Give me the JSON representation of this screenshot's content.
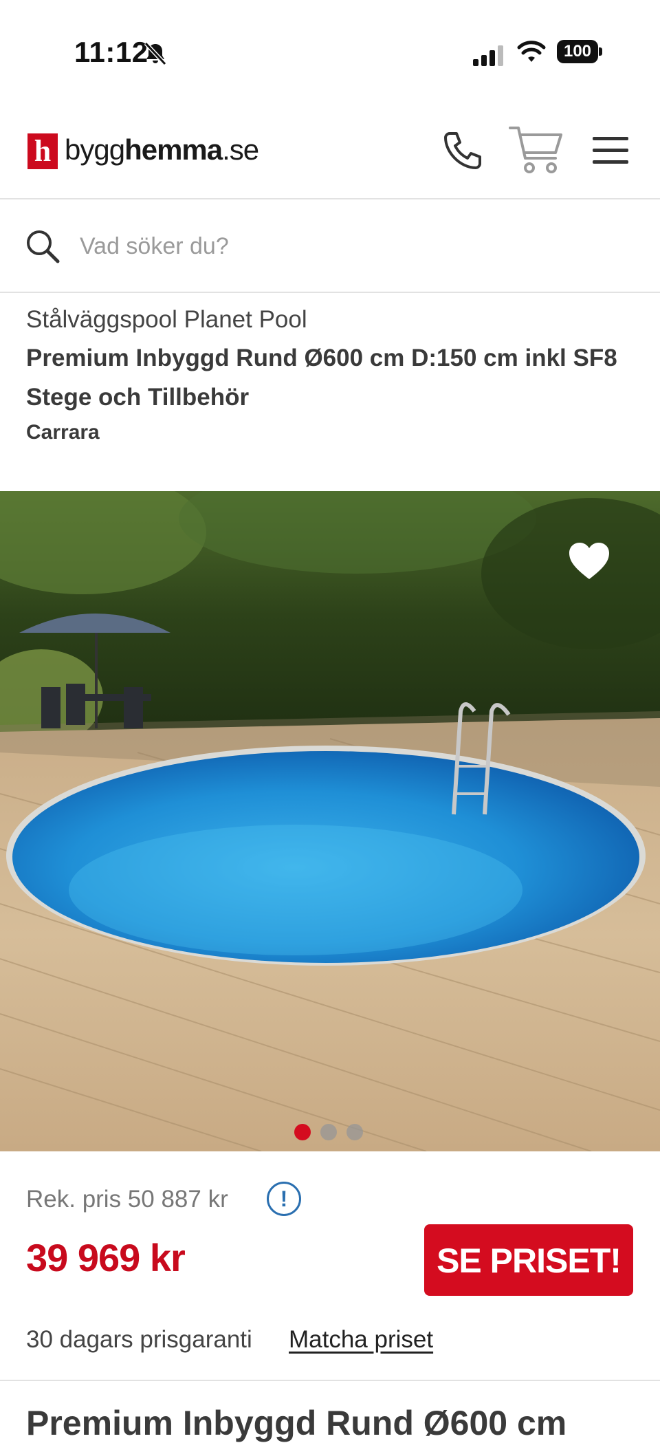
{
  "status": {
    "time": "11:12",
    "battery": "100"
  },
  "header": {
    "logo_letter": "h",
    "logo_prefix": "bygg",
    "logo_bold": "hemma",
    "logo_suffix": ".se"
  },
  "search": {
    "placeholder": "Vad söker du?"
  },
  "product": {
    "series": "Stålväggspool Planet Pool",
    "title": "Premium Inbyggd Rund Ø600 cm D:150 cm inkl SF8 Stege och Tillbehör",
    "brand": "Carrara"
  },
  "gallery": {
    "total_images": 3,
    "active_index": 0
  },
  "pricing": {
    "recommended": "Rek. pris 50 887 kr",
    "info_symbol": "!",
    "price": "39 969 kr",
    "cta_label": "SE PRISET!",
    "guarantee": "30 dagars prisgaranti",
    "match_link": "Matcha priset"
  },
  "section": {
    "title": "Premium Inbyggd Rund Ø600 cm"
  },
  "colors": {
    "brand_red": "#cc0a1e",
    "price_red": "#c80a1d",
    "info_blue": "#2a6fb0"
  }
}
